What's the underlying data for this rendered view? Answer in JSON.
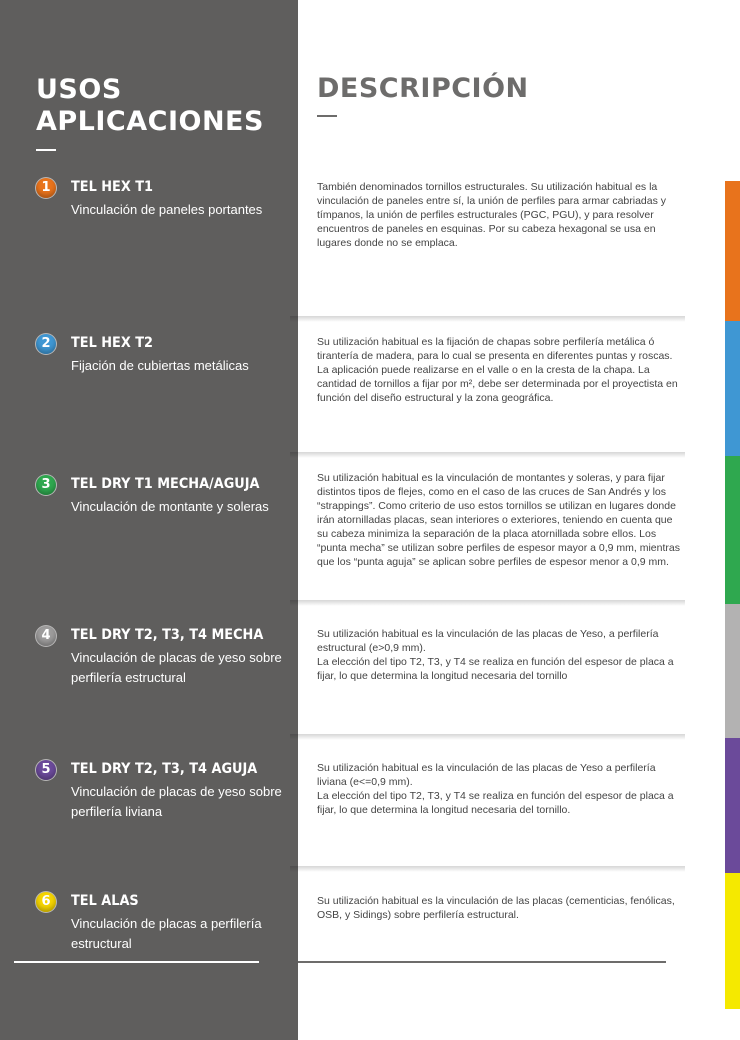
{
  "heading_left": [
    "USOS",
    "APLICACIONES"
  ],
  "heading_right": "DESCRIPCIÓN",
  "items": [
    {
      "num": "1",
      "color": "#e8731c",
      "name": "TEL HEX T1",
      "use": "Vinculación de paneles portantes",
      "desc": [
        "También denominados tornillos estructurales. Su utilización habitual es la vinculación de paneles entre sí, la unión de perfiles para armar cabriadas y tímpanos, la unión de perfiles estructurales (PGC, PGU), y para resolver encuentros de paneles en esquinas. Por su cabeza hexagonal se usa en lugares donde no se emplaca."
      ]
    },
    {
      "num": "2",
      "color": "#3f97d3",
      "name": "TEL HEX T2",
      "use": "Fijación de cubiertas metálicas",
      "desc": [
        "Su utilización habitual es la fijación de chapas sobre perfilería metálica ó tirantería de madera, para lo cual se presenta en diferentes puntas y roscas. La aplicación puede realizarse en el valle o en la cresta de la chapa. La cantidad de tornillos a fijar por m², debe ser determinada por el proyectista en función del diseño estructural y la zona geográfica."
      ]
    },
    {
      "num": "3",
      "color": "#2fa84f",
      "name": "TEL DRY T1 MECHA/AGUJA",
      "use": "Vinculación de montante y soleras",
      "desc": [
        "Su utilización habitual es la vinculación de montantes y soleras, y para fijar distintos tipos de flejes, como en el caso de las cruces de San Andrés y los “strappings”. Como criterio de uso estos tornillos se utilizan en lugares donde irán atornilladas placas, sean interiores o exteriores, teniendo en cuenta que su cabeza minimiza la separación de la placa atornillada sobre ellos. Los “punta mecha” se utilizan sobre perfiles de espesor mayor a 0,9 mm, mientras que los “punta aguja” se aplican sobre perfiles de espesor menor a 0,9 mm."
      ]
    },
    {
      "num": "4",
      "color": "#9d9c9c",
      "name": "TEL DRY T2, T3, T4 MECHA",
      "use": "Vinculación de placas de yeso sobre perfilería estructural",
      "desc": [
        "Su utilización habitual es la vinculación de las placas de Yeso, a perfilería estructural (e>0,9 mm).",
        "La elección del tipo T2, T3, y T4 se realiza en función del espesor de placa a fijar, lo que determina la longitud necesaria del tornillo"
      ]
    },
    {
      "num": "5",
      "color": "#6b4a9a",
      "name": "TEL DRY T2, T3, T4 AGUJA",
      "use": "Vinculación de placas de yeso sobre perfilería liviana",
      "desc": [
        "Su utilización habitual es la vinculación de las placas de Yeso a perfilería liviana (e<=0,9  mm).",
        "La elección del tipo T2, T3, y T4 se realiza en función del espesor de placa a fijar, lo que determina la longitud necesaria del tornillo."
      ]
    },
    {
      "num": "6",
      "color": "#f5d400",
      "name": "TEL ALAS",
      "use": "Vinculación de placas a perfilería estructural",
      "desc": [
        "Su utilización habitual es la vinculación de las placas (cementicias, fenólicas, OSB, y Sidings) sobre perfilería estructural."
      ]
    }
  ],
  "color_bar": [
    "#e8731c",
    "#3f97d3",
    "#2fa84f",
    "#b3b2b2",
    "#6b4a9a",
    "#f5e900"
  ]
}
